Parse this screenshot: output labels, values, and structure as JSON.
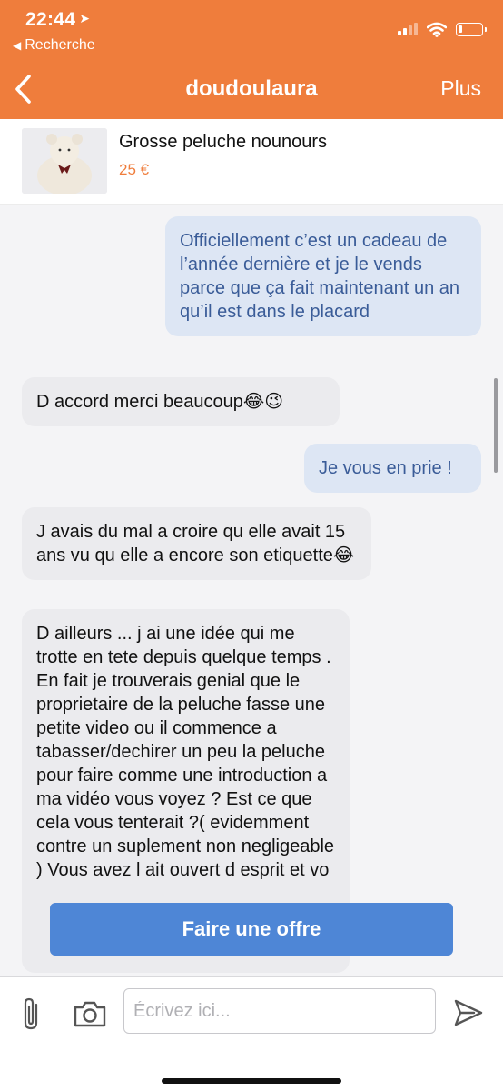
{
  "status_bar": {
    "time": "22:44",
    "back_label": "Recherche"
  },
  "nav": {
    "title": "doudoulaura",
    "more_label": "Plus"
  },
  "product": {
    "title": "Grosse peluche nounours",
    "price": "25 €"
  },
  "messages": [
    {
      "direction": "out",
      "text": "Officiellement c’est un cadeau de l’année dernière et je le vends parce que ça fait maintenant un an qu’il est dans le placard"
    },
    {
      "direction": "in",
      "text": "D accord merci beaucoup😂😉"
    },
    {
      "direction": "out",
      "text": "Je vous en prie !"
    },
    {
      "direction": "in",
      "text": "J avais du mal a croire qu elle avait 15 ans vu qu elle a encore son etiquette😂"
    },
    {
      "direction": "in",
      "text": "D ailleurs ... j ai une idée qui me trotte en tete depuis quelque temps . En fait je trouverais genial que le proprietaire de la peluche fasse une petite video ou il commence a tabasser/dechirer un peu la peluche pour faire comme une introduction a ma vidéo vous voyez ? Est ce que cela vous tenterait ?( evidemment contre un suplement non negligeable ) Vous avez l ait ouvert d esprit et vo"
    }
  ],
  "offer_button": {
    "label": "Faire une offre"
  },
  "composer": {
    "placeholder": "Écrivez ici..."
  },
  "colors": {
    "brand_orange": "#ef7d3c",
    "offer_blue": "#4e86d6",
    "outgoing_bubble": "#dde6f4",
    "incoming_bubble": "#ebebee"
  },
  "icons": [
    "location-arrow-icon",
    "signal-icon",
    "wifi-icon",
    "battery-icon",
    "back-chevron-icon",
    "paperclip-icon",
    "camera-icon",
    "send-icon"
  ]
}
